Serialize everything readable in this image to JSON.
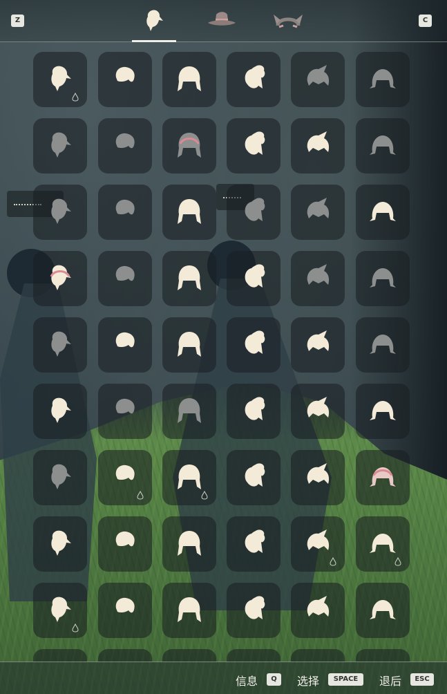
{
  "topbar": {
    "left_key": "Z",
    "right_key": "C",
    "tabs": [
      {
        "name": "hair",
        "icon": "hair-icon",
        "active": true
      },
      {
        "name": "hat",
        "icon": "hat-icon",
        "active": false
      },
      {
        "name": "horns",
        "icon": "horns-icon",
        "active": false
      }
    ]
  },
  "grid": {
    "columns": 6,
    "slots": [
      {
        "icon": "ponytail-hair-icon",
        "tone": "light",
        "badge": true
      },
      {
        "icon": "short-hair-icon",
        "tone": "light",
        "badge": false
      },
      {
        "icon": "twin-braids-hair-icon",
        "tone": "light",
        "badge": false
      },
      {
        "icon": "side-ponytail-hair-icon",
        "tone": "light",
        "badge": false
      },
      {
        "icon": "top-knot-hair-icon",
        "tone": "gray",
        "badge": false
      },
      {
        "icon": "pigtails-hair-icon",
        "tone": "gray",
        "badge": false
      },
      {
        "icon": "bow-hair-icon",
        "tone": "gray",
        "badge": false
      },
      {
        "icon": "big-bow-hair-icon",
        "tone": "gray",
        "badge": false
      },
      {
        "icon": "headband-hair-icon",
        "tone": "gray",
        "badge": false
      },
      {
        "icon": "bob-hair-icon",
        "tone": "light",
        "badge": false
      },
      {
        "icon": "swept-hair-icon",
        "tone": "light",
        "badge": false
      },
      {
        "icon": "spiky-hair-icon",
        "tone": "gray",
        "badge": false
      },
      {
        "icon": "long-hair-icon",
        "tone": "gray",
        "badge": false
      },
      {
        "icon": "braids-hair-icon",
        "tone": "gray",
        "badge": false
      },
      {
        "icon": "pointed-hair-icon",
        "tone": "light",
        "badge": false
      },
      {
        "icon": "bob-bangs-hair-icon",
        "tone": "gray",
        "badge": false
      },
      {
        "icon": "parted-long-hair-icon",
        "tone": "gray",
        "badge": false
      },
      {
        "icon": "flame-hair-icon",
        "tone": "light",
        "badge": false
      },
      {
        "icon": "headband-short-hair-icon",
        "tone": "light",
        "badge": false
      },
      {
        "icon": "side-sweep-hair-icon",
        "tone": "gray",
        "badge": false
      },
      {
        "icon": "leaf-hair-icon",
        "tone": "light",
        "badge": false
      },
      {
        "icon": "curly-hair-icon",
        "tone": "light",
        "badge": false
      },
      {
        "icon": "straight-long-hair-icon",
        "tone": "gray",
        "badge": false
      },
      {
        "icon": "mustache-hair-icon",
        "tone": "gray",
        "badge": false
      },
      {
        "icon": "low-bun-hair-icon",
        "tone": "gray",
        "badge": false
      },
      {
        "icon": "crown-spike-hair-icon",
        "tone": "light",
        "badge": false
      },
      {
        "icon": "afro-hair-icon",
        "tone": "light",
        "badge": false
      },
      {
        "icon": "round-hair-icon",
        "tone": "light",
        "badge": false
      },
      {
        "icon": "bun-hair-icon",
        "tone": "light",
        "badge": false
      },
      {
        "icon": "double-bun-hair-icon",
        "tone": "gray",
        "badge": false
      },
      {
        "icon": "heart-hair-icon",
        "tone": "light",
        "badge": false
      },
      {
        "icon": "wings-hair-icon",
        "tone": "gray",
        "badge": false
      },
      {
        "icon": "long-curtain-hair-icon",
        "tone": "gray",
        "badge": false
      },
      {
        "icon": "fish-hair-icon",
        "tone": "light",
        "badge": false
      },
      {
        "icon": "spread-hair-icon",
        "tone": "light",
        "badge": false
      },
      {
        "icon": "side-braid-hair-icon",
        "tone": "light",
        "badge": false
      },
      {
        "icon": "hood-hair-icon",
        "tone": "gray",
        "badge": false
      },
      {
        "icon": "cone-hair-icon",
        "tone": "light",
        "badge": true
      },
      {
        "icon": "bun-bow-hair-icon",
        "tone": "light",
        "badge": true
      },
      {
        "icon": "flare-hair-icon",
        "tone": "light",
        "badge": false
      },
      {
        "icon": "pulled-back-hair-icon",
        "tone": "light",
        "badge": false
      },
      {
        "icon": "pink-buns-hair-icon",
        "tone": "pink",
        "badge": false
      },
      {
        "icon": "wavy-bob-hair-icon",
        "tone": "light",
        "badge": false
      },
      {
        "icon": "curly-bob-hair-icon",
        "tone": "light",
        "badge": false
      },
      {
        "icon": "round-bob-hair-icon",
        "tone": "light",
        "badge": false
      },
      {
        "icon": "high-ponytail-hair-icon",
        "tone": "light",
        "badge": false
      },
      {
        "icon": "big-curls-hair-icon",
        "tone": "light",
        "badge": true
      },
      {
        "icon": "topknot-bun-hair-icon",
        "tone": "light",
        "badge": true
      },
      {
        "icon": "feather-hair-icon",
        "tone": "light",
        "badge": true
      },
      {
        "icon": "wild-hair-icon",
        "tone": "light",
        "badge": false
      },
      {
        "icon": "ringlets-hair-icon",
        "tone": "light",
        "badge": false
      },
      {
        "icon": "cap-hair-icon",
        "tone": "light",
        "badge": false
      },
      {
        "icon": "crown-hair-icon",
        "tone": "light",
        "badge": false
      },
      {
        "icon": "pointed-hat-hair-icon",
        "tone": "light",
        "badge": false
      },
      {
        "icon": "partial-1-hair-icon",
        "tone": "light",
        "badge": false
      },
      {
        "icon": "partial-2-hair-icon",
        "tone": "light",
        "badge": false
      },
      {
        "icon": "partial-3-hair-icon",
        "tone": "light",
        "badge": false
      },
      {
        "icon": "partial-4-hair-icon",
        "tone": "light",
        "badge": false
      },
      {
        "icon": "partial-5-hair-icon",
        "tone": "light",
        "badge": false
      },
      {
        "icon": "partial-6-hair-icon",
        "tone": "light",
        "badge": false
      }
    ]
  },
  "bottombar": {
    "info_label": "信息",
    "info_key": "Q",
    "select_label": "选择",
    "select_key": "SPACE",
    "back_label": "退后",
    "back_key": "ESC"
  },
  "colors": {
    "icon_light": "#f3ead8",
    "icon_gray": "#8d8f8e",
    "accent_pink": "#d98a92",
    "slot_bg": "#181e20"
  }
}
